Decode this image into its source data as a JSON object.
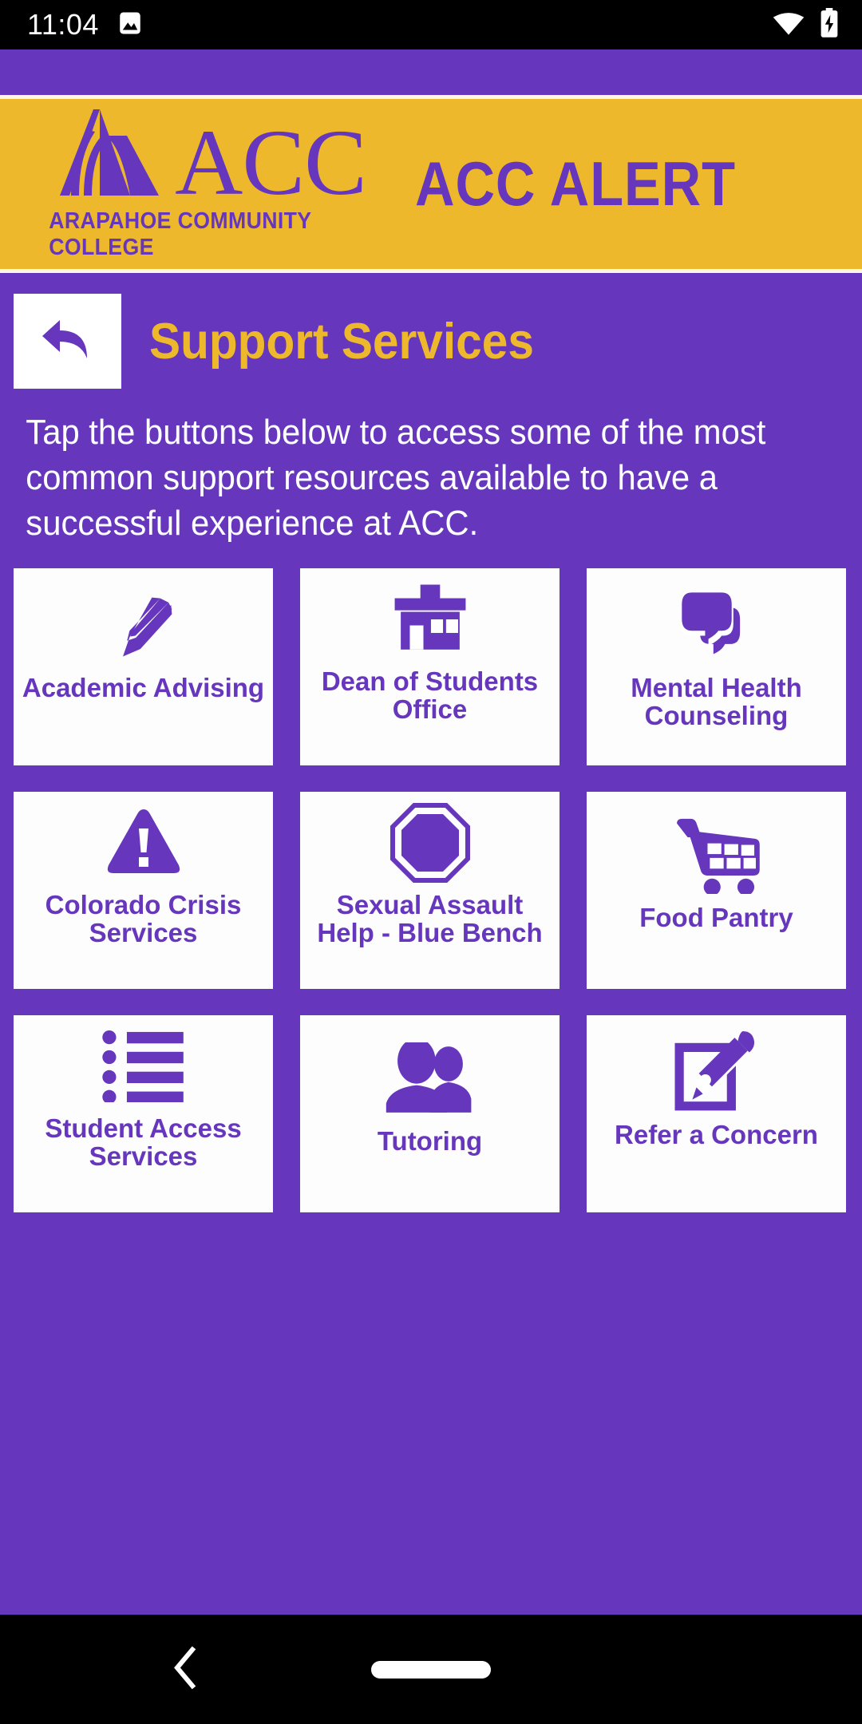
{
  "statusbar": {
    "time": "11:04",
    "left_icons": [
      "image-icon"
    ],
    "right_icons": [
      "wifi-icon",
      "battery-charging-icon"
    ]
  },
  "brand": {
    "logo_acc": "ACC",
    "logo_subtitle": "ARAPAHOE COMMUNITY COLLEGE",
    "alert_title": "ACC ALERT",
    "gold": "#edb82c",
    "purple": "#6637bd"
  },
  "header": {
    "back_icon": "back-arrow-icon",
    "page_title": "Support Services"
  },
  "main": {
    "description": "Tap the buttons below to access some of the most common support resources available to have a successful experience at ACC.",
    "tiles": [
      {
        "label": "Academic Advising",
        "icon": "pen-nib-icon",
        "lines": 2
      },
      {
        "label": "Dean of Students Office",
        "icon": "building-icon",
        "lines": 3
      },
      {
        "label": "Mental Health Counseling",
        "icon": "speech-bubbles-icon",
        "lines": 2
      },
      {
        "label": "Colorado Crisis Services",
        "icon": "warning-triangle-icon",
        "lines": 3
      },
      {
        "label": "Sexual Assault Help - Blue Bench",
        "icon": "octagon-stop-icon",
        "lines": 3
      },
      {
        "label": "Food Pantry",
        "icon": "shopping-cart-icon",
        "lines": 1
      },
      {
        "label": "Student Access Services",
        "icon": "bulleted-list-icon",
        "lines": 3
      },
      {
        "label": "Tutoring",
        "icon": "two-people-icon",
        "lines": 1
      },
      {
        "label": "Refer a Concern",
        "icon": "pencil-form-icon",
        "lines": 2
      }
    ]
  },
  "navbar": {
    "back_icon": "nav-back-chevron-icon",
    "home_icon": "nav-home-pill-icon"
  }
}
